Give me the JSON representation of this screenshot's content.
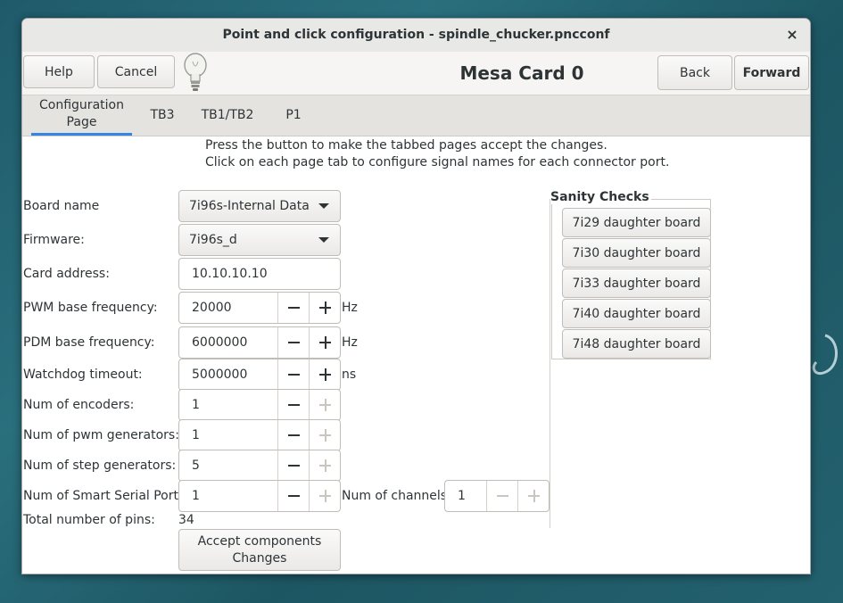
{
  "window": {
    "title": "Point and click configuration - spindle_chucker.pncconf",
    "close": "×"
  },
  "header": {
    "help": "Help",
    "cancel": "Cancel",
    "title": "Mesa Card 0",
    "back": "Back",
    "forward": "Forward"
  },
  "tabs": [
    {
      "label": "Configuration Page",
      "active": true
    },
    {
      "label": "TB3"
    },
    {
      "label": "TB1/TB2"
    },
    {
      "label": "P1"
    }
  ],
  "notes": {
    "line1": "Press the button to make the tabbed pages accept the changes.",
    "line2": "Click on each page tab to configure signal names for each connector port."
  },
  "form": {
    "board_name": {
      "label": "Board name",
      "value": "7i96s-Internal Data"
    },
    "firmware": {
      "label": "Firmware:",
      "value": "7i96s_d"
    },
    "card_address": {
      "label": "Card address:",
      "value": "10.10.10.10"
    },
    "pwm_freq": {
      "label": "PWM base frequency:",
      "value": "20000",
      "unit": "Hz"
    },
    "pdm_freq": {
      "label": "PDM base frequency:",
      "value": "6000000",
      "unit": "Hz"
    },
    "watchdog": {
      "label": "Watchdog timeout:",
      "value": "5000000",
      "unit": "ns"
    },
    "encoders": {
      "label": "Num of encoders:",
      "value": "1"
    },
    "pwm_gens": {
      "label": "Num of pwm generators:",
      "value": "1"
    },
    "step_gens": {
      "label": "Num of step generators:",
      "value": "5"
    },
    "sserial": {
      "label": "Num of Smart Serial Ports:",
      "value": "1"
    },
    "channels": {
      "label": "Num of channels:",
      "value": "1"
    },
    "total_pins": {
      "label": "Total number of pins:",
      "value": "34"
    },
    "accept": "Accept  components\nChanges"
  },
  "sanity": {
    "title": "Sanity Checks",
    "buttons": [
      "7i29 daughter board",
      "7i30 daughter board",
      "7i33 daughter board",
      "7i40 daughter board",
      "7i48 daughter board"
    ]
  }
}
